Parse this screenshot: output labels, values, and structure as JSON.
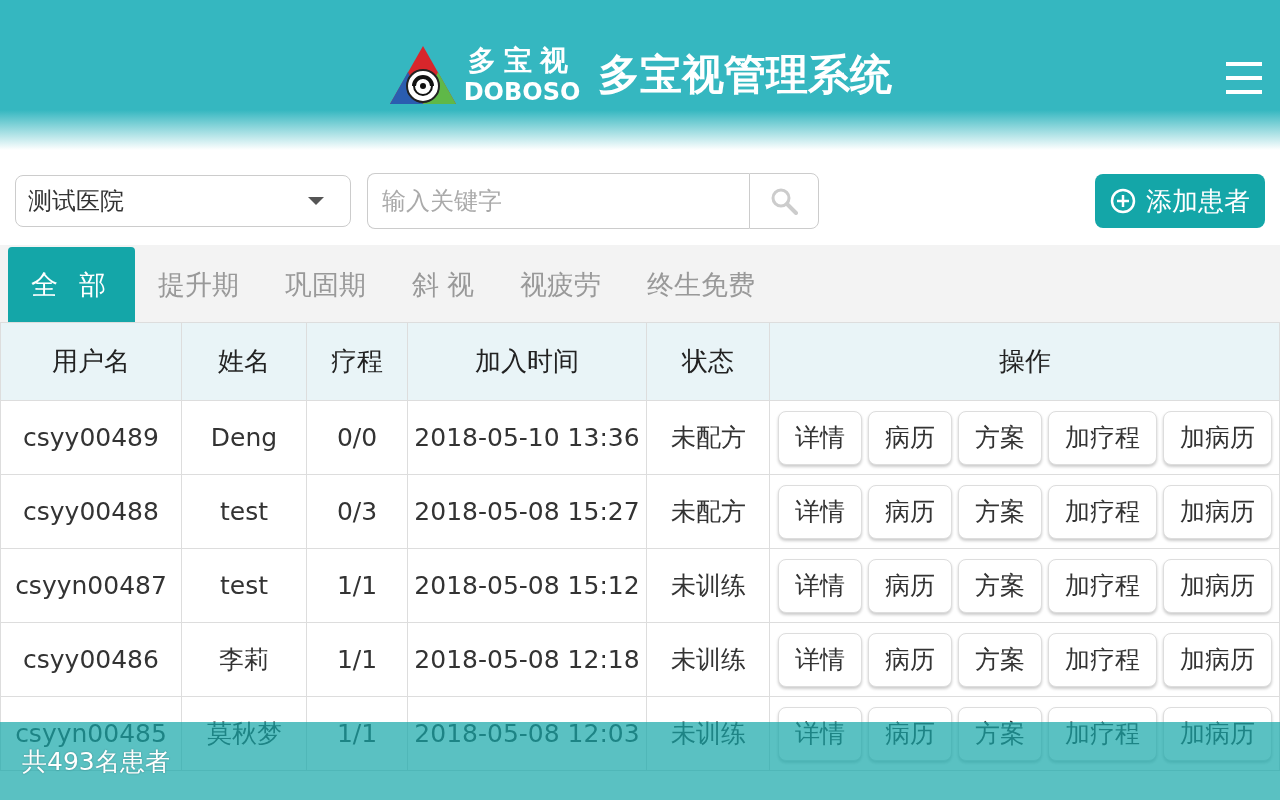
{
  "header": {
    "logo_cn": "多宝视",
    "logo_en": "DOBOSO",
    "title": "多宝视管理系统"
  },
  "hospital_select": {
    "value": "测试医院"
  },
  "search": {
    "placeholder": "输入关键字"
  },
  "add_button": {
    "label": "添加患者"
  },
  "tabs": [
    {
      "label": "全 部",
      "selected": true
    },
    {
      "label": "提升期",
      "selected": false
    },
    {
      "label": "巩固期",
      "selected": false
    },
    {
      "label": "斜 视",
      "selected": false
    },
    {
      "label": "视疲劳",
      "selected": false
    },
    {
      "label": "终生免费",
      "selected": false
    }
  ],
  "table": {
    "columns": [
      "用户名",
      "姓名",
      "疗程",
      "加入时间",
      "状态",
      "操作"
    ],
    "rows": [
      {
        "cells": [
          "csyy00489",
          "Deng",
          "0/0",
          "2018-05-10 13:36",
          "未配方"
        ],
        "actions": [
          "详情",
          "病历",
          "方案",
          "加疗程",
          "加病历"
        ]
      },
      {
        "cells": [
          "csyy00488",
          "test",
          "0/3",
          "2018-05-08 15:27",
          "未配方"
        ],
        "actions": [
          "详情",
          "病历",
          "方案",
          "加疗程",
          "加病历"
        ]
      },
      {
        "cells": [
          "csyyn00487",
          "test",
          "1/1",
          "2018-05-08 15:12",
          "未训练"
        ],
        "actions": [
          "详情",
          "病历",
          "方案",
          "加疗程",
          "加病历"
        ]
      },
      {
        "cells": [
          "csyy00486",
          "李莉",
          "1/1",
          "2018-05-08 12:18",
          "未训练"
        ],
        "actions": [
          "详情",
          "病历",
          "方案",
          "加疗程",
          "加病历"
        ]
      },
      {
        "cells": [
          "csyyn00485",
          "莫秋梦",
          "1/1",
          "2018-05-08 12:03",
          "未训练"
        ],
        "actions": [
          "详情",
          "病历",
          "方案",
          "加疗程",
          "加病历"
        ]
      }
    ]
  },
  "footer": {
    "total": "共493名患者"
  }
}
